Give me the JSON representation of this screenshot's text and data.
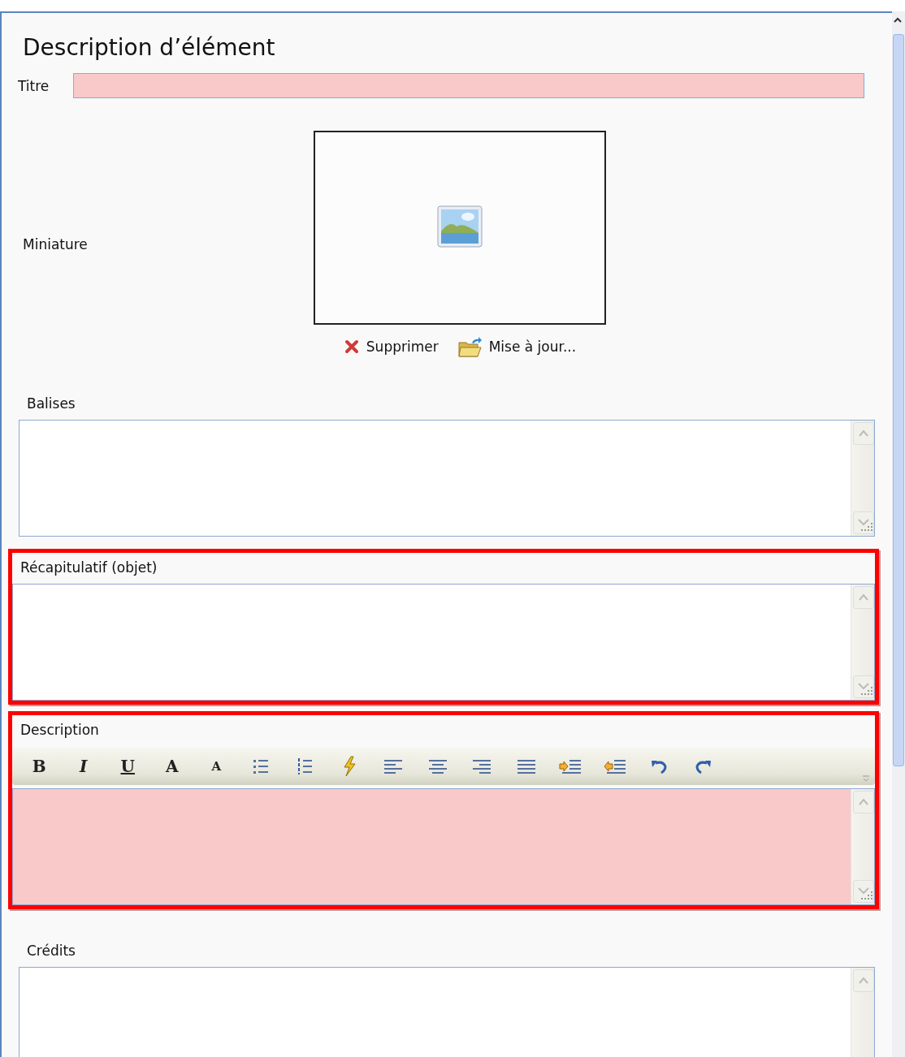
{
  "title": "Description d’élément",
  "fields": [
    {
      "kind": "text",
      "label": "Titre",
      "required": true
    },
    {
      "kind": "thumbnail",
      "label": "Miniature",
      "actions": [
        {
          "kind": "delete",
          "label": "Supprimer"
        },
        {
          "kind": "update",
          "label": "Mise à jour..."
        }
      ]
    },
    {
      "kind": "textarea",
      "label": "Balises",
      "highlighted": false,
      "required": false
    },
    {
      "kind": "textarea",
      "label": "Récapitulatif (objet)",
      "highlighted": true,
      "required": false
    },
    {
      "kind": "richtext",
      "label": "Description",
      "highlighted": true,
      "required": true,
      "toolbar": [
        {
          "kind": "bold",
          "glyph": "B"
        },
        {
          "kind": "italic",
          "glyph": "I"
        },
        {
          "kind": "underline",
          "glyph": "U"
        },
        {
          "kind": "grow",
          "glyph": "A"
        },
        {
          "kind": "shrink",
          "glyph": "A"
        },
        {
          "kind": "bullets"
        },
        {
          "kind": "numbers"
        },
        {
          "kind": "clean"
        },
        {
          "kind": "left"
        },
        {
          "kind": "center"
        },
        {
          "kind": "right"
        },
        {
          "kind": "justify"
        },
        {
          "kind": "indent"
        },
        {
          "kind": "outdent"
        },
        {
          "kind": "undo"
        },
        {
          "kind": "redo"
        }
      ]
    },
    {
      "kind": "textarea",
      "label": "Crédits",
      "highlighted": false,
      "required": false
    }
  ]
}
